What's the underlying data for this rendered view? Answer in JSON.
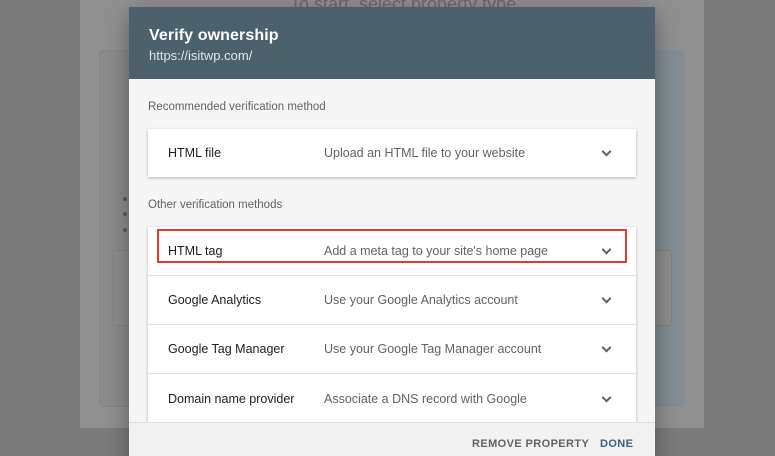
{
  "background": {
    "heading_fragment": "To start, select property type"
  },
  "dialog": {
    "title": "Verify ownership",
    "subtitle": "https://isitwp.com/"
  },
  "recommended": {
    "label": "Recommended verification method",
    "methods": [
      {
        "name": "HTML file",
        "description": "Upload an HTML file to your website"
      }
    ]
  },
  "other": {
    "label": "Other verification methods",
    "methods": [
      {
        "name": "HTML tag",
        "description": "Add a meta tag to your site's home page",
        "highlighted": true
      },
      {
        "name": "Google Analytics",
        "description": "Use your Google Analytics account"
      },
      {
        "name": "Google Tag Manager",
        "description": "Use your Google Tag Manager account"
      },
      {
        "name": "Domain name provider",
        "description": "Associate a DNS record with Google"
      }
    ]
  },
  "footer": {
    "remove_label": "REMOVE PROPERTY",
    "done_label": "DONE"
  },
  "colors": {
    "header_bg": "#4c616b",
    "highlight_border": "#e33b2a",
    "done_text": "#3c5f7a"
  },
  "icons": {
    "expand": "chevron-down-icon"
  }
}
